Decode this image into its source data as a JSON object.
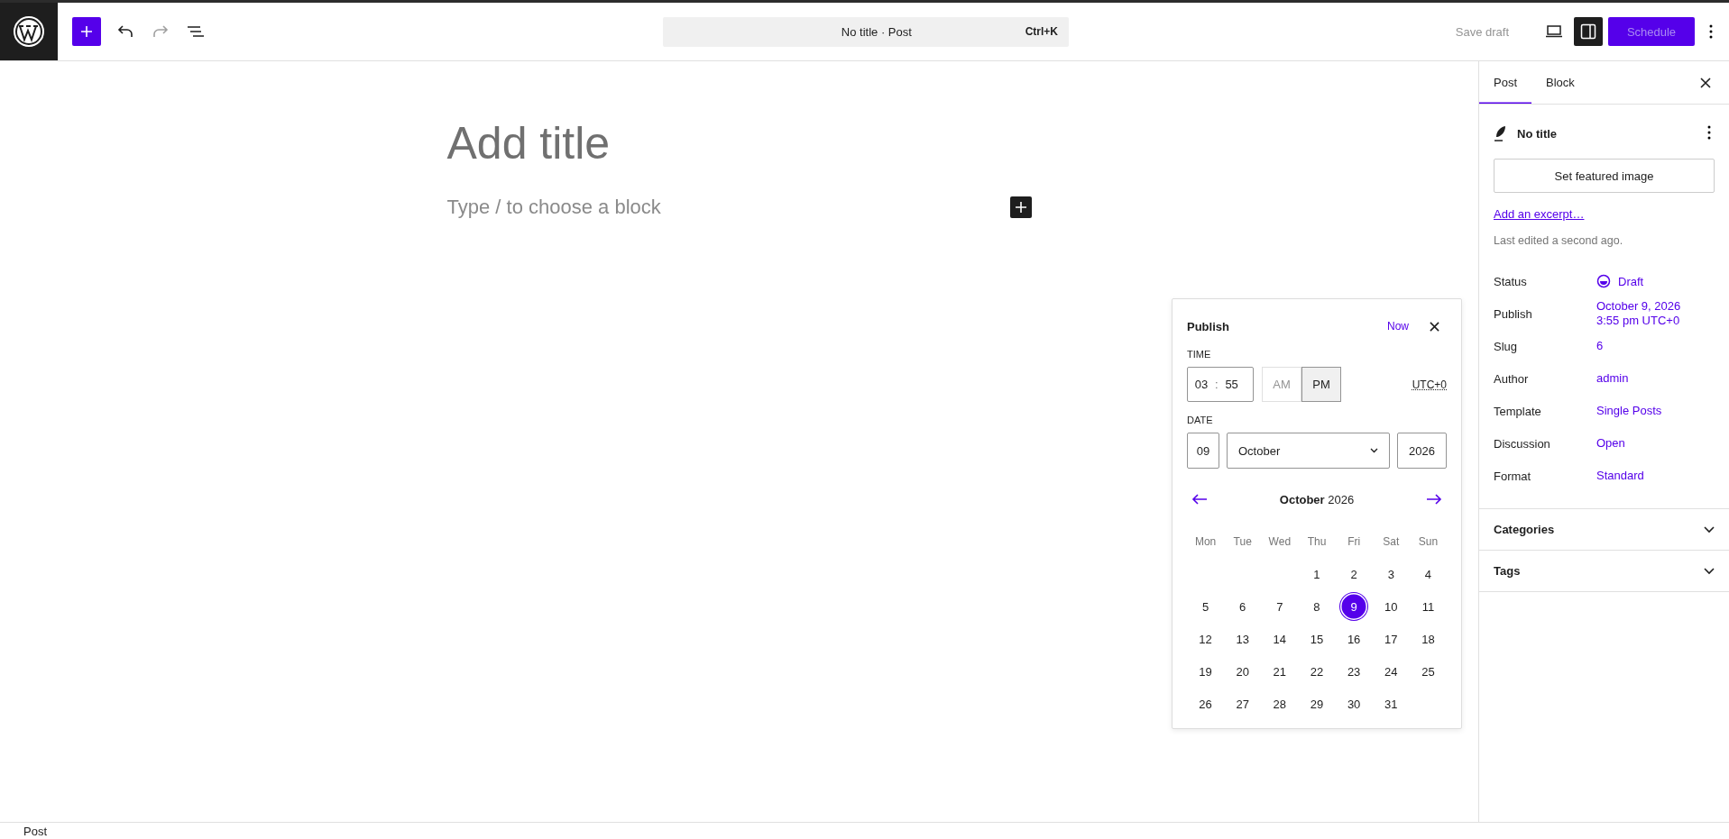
{
  "toolbar": {
    "tools": [
      {
        "kind": "inserter",
        "disabled": false
      },
      {
        "kind": "undo",
        "disabled": false
      },
      {
        "kind": "redo",
        "disabled": true
      },
      {
        "kind": "outline",
        "disabled": false
      }
    ],
    "command_bar": {
      "title": "No title · Post",
      "shortcut": "Ctrl+K"
    },
    "save_draft": {
      "label": "Save draft",
      "disabled": true
    },
    "sidebar_toggle": {
      "pressed": true
    },
    "schedule": {
      "label": "Schedule",
      "disabled": true
    }
  },
  "editor": {
    "title_placeholder": "Add title",
    "block_placeholder": "Type / to choose a block"
  },
  "sidebar": {
    "tabs": [
      {
        "label": "Post",
        "selected": true
      },
      {
        "label": "Block",
        "selected": false
      }
    ],
    "post_title": "No title",
    "featured_image_button": "Set featured image",
    "excerpt_link": "Add an excerpt…",
    "last_edited": "Last edited a second ago.",
    "rows": [
      {
        "label": "Status",
        "kind": "status",
        "lines": [
          "Draft"
        ]
      },
      {
        "label": "Publish",
        "kind": "link",
        "lines": [
          "October 9, 2026",
          "3:55 pm UTC+0"
        ]
      },
      {
        "label": "Slug",
        "kind": "link",
        "lines": [
          "6"
        ]
      },
      {
        "label": "Author",
        "kind": "link",
        "lines": [
          "admin"
        ]
      },
      {
        "label": "Template",
        "kind": "link",
        "lines": [
          "Single Posts"
        ]
      },
      {
        "label": "Discussion",
        "kind": "link",
        "lines": [
          "Open"
        ]
      },
      {
        "label": "Format",
        "kind": "link",
        "lines": [
          "Standard"
        ]
      }
    ],
    "panels": [
      {
        "title": "Categories",
        "expanded": false
      },
      {
        "title": "Tags",
        "expanded": false
      }
    ]
  },
  "publish_popover": {
    "title": "Publish",
    "now_button": "Now",
    "time_label": "TIME",
    "hours": "03",
    "time_separator": ":",
    "minutes": "55",
    "meridiem": [
      {
        "label": "AM",
        "selected": false
      },
      {
        "label": "PM",
        "selected": true
      }
    ],
    "timezone": "UTC+0",
    "date_label": "DATE",
    "day": "09",
    "month": "October",
    "year": "2026",
    "calendar": {
      "month": "October",
      "year": "2026",
      "weekdays": [
        "Mon",
        "Tue",
        "Wed",
        "Thu",
        "Fri",
        "Sat",
        "Sun"
      ],
      "weeks": [
        [
          {
            "day": "1",
            "selected": false
          },
          {
            "day": "2",
            "selected": false
          },
          {
            "day": "3",
            "selected": false
          },
          {
            "day": "4",
            "selected": false
          }
        ],
        [
          {
            "day": "5",
            "selected": false
          },
          {
            "day": "6",
            "selected": false
          },
          {
            "day": "7",
            "selected": false
          },
          {
            "day": "8",
            "selected": false
          },
          {
            "day": "9",
            "selected": true
          },
          {
            "day": "10",
            "selected": false
          },
          {
            "day": "11",
            "selected": false
          }
        ],
        [
          {
            "day": "12",
            "selected": false
          },
          {
            "day": "13",
            "selected": false
          },
          {
            "day": "14",
            "selected": false
          },
          {
            "day": "15",
            "selected": false
          },
          {
            "day": "16",
            "selected": false
          },
          {
            "day": "17",
            "selected": false
          },
          {
            "day": "18",
            "selected": false
          }
        ],
        [
          {
            "day": "19",
            "selected": false
          },
          {
            "day": "20",
            "selected": false
          },
          {
            "day": "21",
            "selected": false
          },
          {
            "day": "22",
            "selected": false
          },
          {
            "day": "23",
            "selected": false
          },
          {
            "day": "24",
            "selected": false
          },
          {
            "day": "25",
            "selected": false
          }
        ],
        [
          {
            "day": "26",
            "selected": false
          },
          {
            "day": "27",
            "selected": false
          },
          {
            "day": "28",
            "selected": false
          },
          {
            "day": "29",
            "selected": false
          },
          {
            "day": "30",
            "selected": false
          },
          {
            "day": "31",
            "selected": false
          }
        ]
      ]
    }
  },
  "footer": {
    "breadcrumb": "Post"
  }
}
